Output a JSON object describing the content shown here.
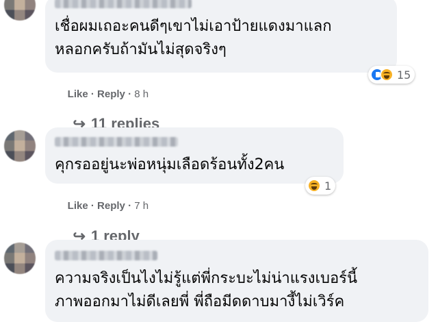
{
  "comments": [
    {
      "text_lines": [
        "เชื่อผมเถอะคนดีๆเขาไม่เอาป้ายแดงมาแลก",
        "หลอกครับถ้ามันไม่สุดจริงๆ"
      ],
      "reactions": {
        "icons": [
          "like-icon",
          "haha-icon"
        ],
        "count": "15"
      },
      "like_label": "Like",
      "reply_label": "Reply",
      "time": "8 h",
      "replies_label": "11 replies"
    },
    {
      "text_lines": [
        "คุกรออยู่นะพ่อหนุ่มเลือดร้อนทั้ง2คน"
      ],
      "reactions": {
        "icons": [
          "haha-icon"
        ],
        "count": "1"
      },
      "like_label": "Like",
      "reply_label": "Reply",
      "time": "7 h",
      "replies_label": "1 reply"
    },
    {
      "text_lines": [
        "ความจริงเป็นไงไม่รู้แต่พี่กระบะไม่น่าแรงเบอร์นี้",
        "ภาพออกมาไม่ดีเลยพี่ พี่ถือมีดดาบมางี้ไม่เวิร์ค"
      ]
    }
  ],
  "separator": "·",
  "reply_arrow": "↪"
}
